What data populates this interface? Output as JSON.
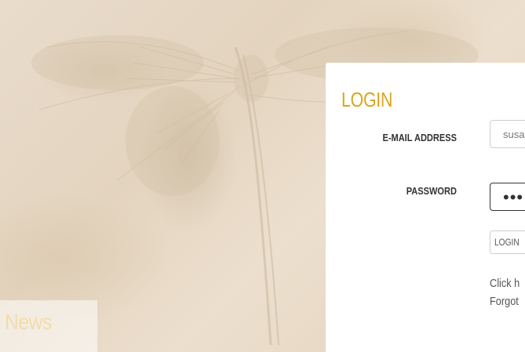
{
  "news": {
    "title": "News"
  },
  "login": {
    "heading": "LOGIN",
    "email_label": "E-MAIL ADDRESS",
    "email_value": "susa",
    "password_label": "PASSWORD",
    "password_value": "•••",
    "button_label": "LOGIN",
    "help_line_1": "Click h",
    "help_line_2": "Forgot"
  },
  "colors": {
    "heading": "#dba41d",
    "news_title": "#f3dcaa",
    "background": "#e6d8c4"
  }
}
